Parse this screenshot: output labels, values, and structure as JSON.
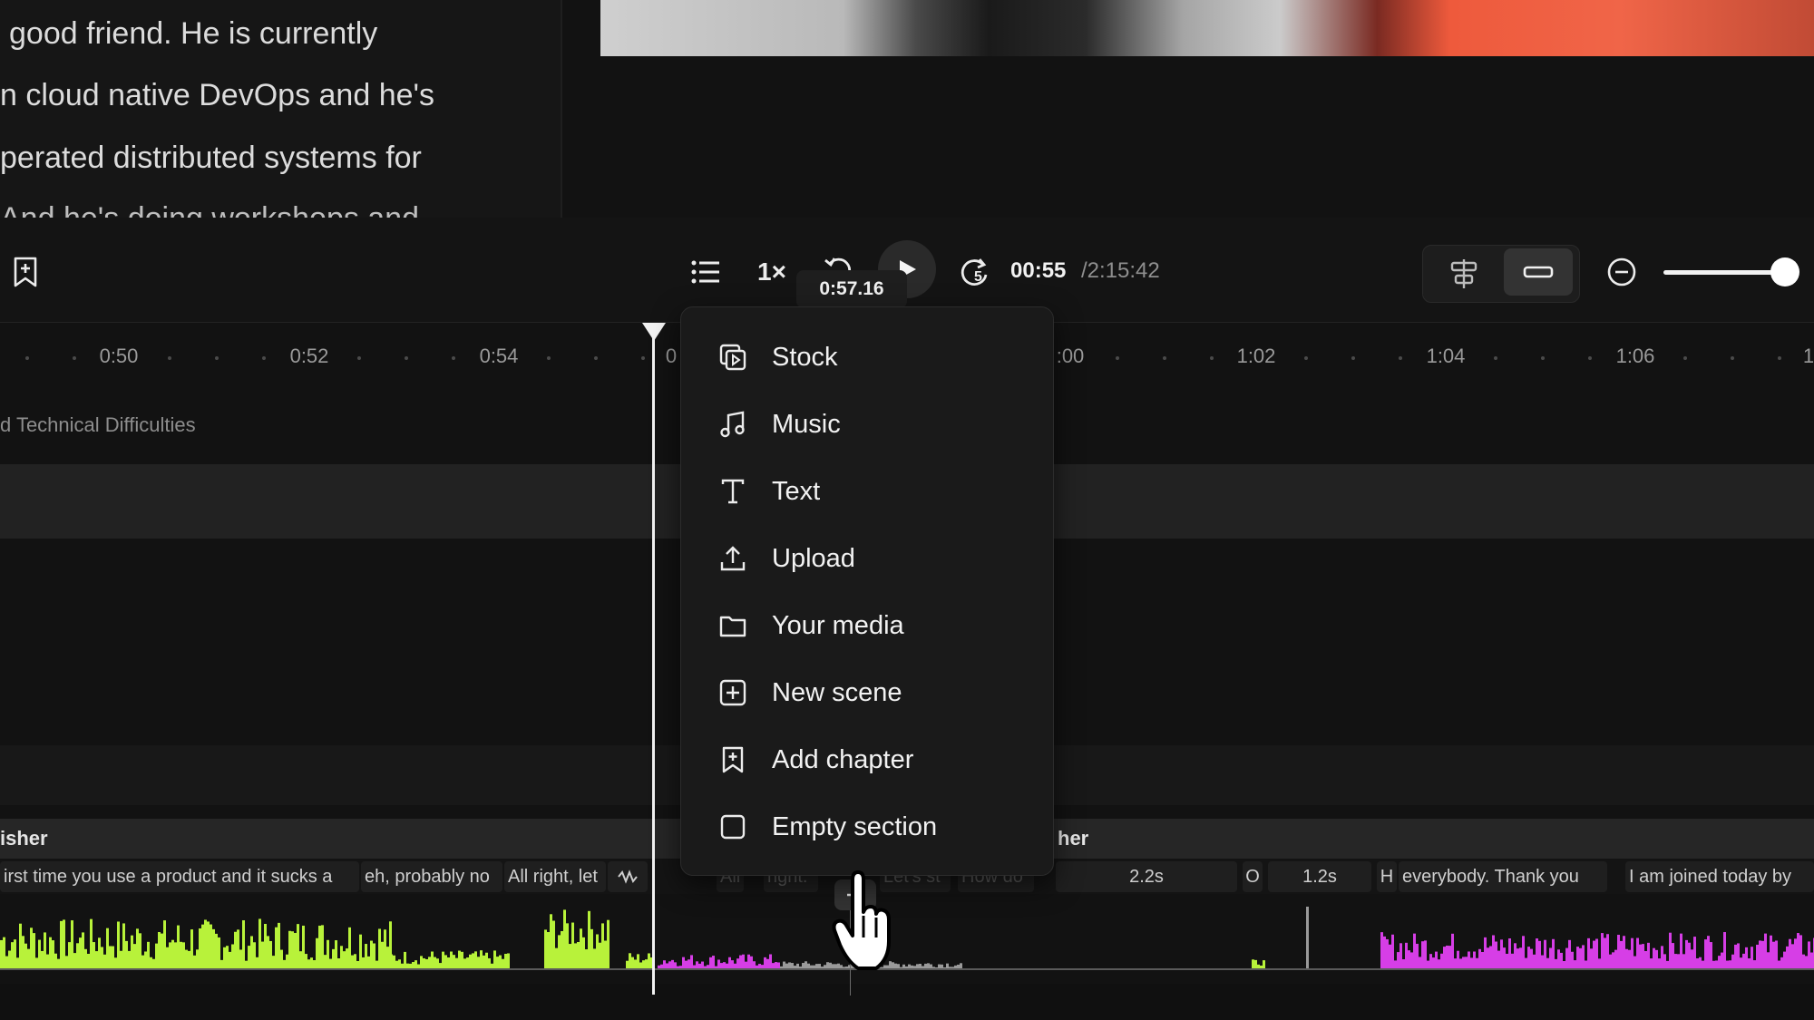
{
  "transcript": {
    "lines": [
      "good friend. He is currently",
      "n cloud native DevOps and he's",
      "perated distributed systems for",
      "And he's doing workshops and"
    ]
  },
  "toolbar": {
    "speed": "1×",
    "skip_forward_seconds": "5",
    "current_time": "00:55",
    "total_time": "/2:15:42",
    "tooltip": "0:57.16"
  },
  "ruler": {
    "ticks": [
      "0:50",
      "0:52",
      "0:54",
      "0",
      ":00",
      "1:02",
      "1:04",
      "1:06",
      "1"
    ]
  },
  "tracks": {
    "chapter_label": "d Technical Difficulties",
    "speakers": [
      "isher",
      "her"
    ],
    "captions": [
      "irst time you use a product and it sucks a",
      "eh, probably no",
      "All right, let",
      "All",
      "right.",
      "Let's st",
      "How do",
      "2.2s",
      "O",
      "1.2s",
      "H",
      "everybody. Thank you",
      "I am joined today by"
    ]
  },
  "add_menu": {
    "items": [
      {
        "label": "Stock",
        "icon": "stock-icon"
      },
      {
        "label": "Music",
        "icon": "music-note-icon"
      },
      {
        "label": "Text",
        "icon": "text-icon"
      },
      {
        "label": "Upload",
        "icon": "upload-icon"
      },
      {
        "label": "Your media",
        "icon": "folder-icon"
      },
      {
        "label": "New scene",
        "icon": "plus-square-icon"
      },
      {
        "label": "Add chapter",
        "icon": "bookmark-plus-icon"
      },
      {
        "label": "Empty section",
        "icon": "square-icon"
      }
    ]
  },
  "colors": {
    "waveform_speaker_1": "#b8f23a",
    "waveform_speaker_2": "#d63ee6",
    "background": "#121212",
    "menu_background": "#1a1a1a"
  }
}
